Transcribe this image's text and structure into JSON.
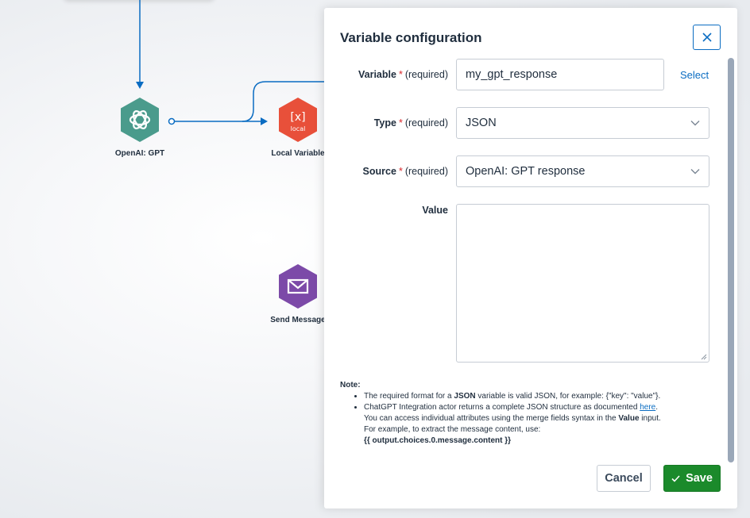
{
  "canvas": {
    "nodes": [
      {
        "label": "OpenAI: GPT",
        "icon": "openai-icon",
        "color": "#4a9b8c"
      },
      {
        "label": "Local Variable",
        "icon": "variable-icon",
        "color": "#e8503a",
        "icon_text": "local",
        "glyph": "[x]"
      },
      {
        "label": "Send Message",
        "icon": "envelope-icon",
        "color": "#7c4aa8"
      }
    ]
  },
  "panel": {
    "title": "Variable configuration",
    "close_icon": "close-icon",
    "required_marker": "*",
    "required_text": "(required)",
    "variable": {
      "label": "Variable",
      "value": "my_gpt_response",
      "select_link": "Select"
    },
    "type": {
      "label": "Type",
      "value": "JSON"
    },
    "source": {
      "label": "Source",
      "value": "OpenAI: GPT response"
    },
    "value_field": {
      "label": "Value",
      "content": ""
    },
    "note": {
      "title": "Note:",
      "item1_pre": "The required format for a ",
      "item1_bold": "JSON",
      "item1_post": " variable is valid JSON, for example: {\"key\": \"value\"}.",
      "item2_pre": "ChatGPT Integration actor returns a complete JSON structure as documented ",
      "item2_link": "here",
      "item2_post": ".",
      "item2_line2_pre": "You can access individual attributes using the merge fields syntax in the ",
      "item2_line2_bold": "Value",
      "item2_line2_post": " input.",
      "item2_line3": "For example, to extract the message content, use:",
      "item2_code": "{{ output.choices.0.message.content }}"
    },
    "buttons": {
      "cancel": "Cancel",
      "save": "Save"
    },
    "colors": {
      "link": "#0a6cc2",
      "save": "#1b8a2b",
      "required": "#d8262a"
    }
  }
}
